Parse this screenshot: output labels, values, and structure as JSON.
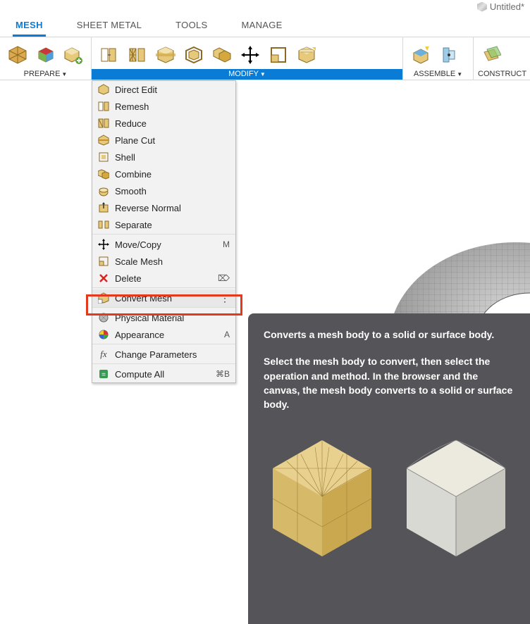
{
  "title": {
    "label": "Untitled*"
  },
  "tabs": [
    {
      "label": "MESH",
      "active": true
    },
    {
      "label": "SHEET METAL",
      "active": false
    },
    {
      "label": "TOOLS",
      "active": false
    },
    {
      "label": "MANAGE",
      "active": false
    }
  ],
  "ribbon": {
    "prepare": {
      "label": "PREPARE"
    },
    "modify": {
      "label": "MODIFY"
    },
    "assemble": {
      "label": "ASSEMBLE"
    },
    "construct": {
      "label": "CONSTRUCT"
    }
  },
  "menu": {
    "items": [
      {
        "icon": "direct-edit-icon",
        "label": "Direct Edit",
        "shortcut": ""
      },
      {
        "icon": "remesh-icon",
        "label": "Remesh",
        "shortcut": ""
      },
      {
        "icon": "reduce-icon",
        "label": "Reduce",
        "shortcut": ""
      },
      {
        "icon": "plane-cut-icon",
        "label": "Plane Cut",
        "shortcut": ""
      },
      {
        "icon": "shell-icon",
        "label": "Shell",
        "shortcut": ""
      },
      {
        "icon": "combine-icon",
        "label": "Combine",
        "shortcut": ""
      },
      {
        "icon": "smooth-icon",
        "label": "Smooth",
        "shortcut": ""
      },
      {
        "icon": "reverse-normal-icon",
        "label": "Reverse Normal",
        "shortcut": ""
      },
      {
        "icon": "separate-icon",
        "label": "Separate",
        "shortcut": ""
      },
      {
        "icon": "move-copy-icon",
        "label": "Move/Copy",
        "shortcut": "M"
      },
      {
        "icon": "scale-mesh-icon",
        "label": "Scale Mesh",
        "shortcut": ""
      },
      {
        "icon": "delete-icon",
        "label": "Delete",
        "shortcut": "⌦"
      },
      {
        "icon": "convert-mesh-icon",
        "label": "Convert Mesh",
        "shortcut": "",
        "highlighted": true,
        "more": true
      },
      {
        "icon": "physical-material-icon",
        "label": "Physical Material",
        "shortcut": ""
      },
      {
        "icon": "appearance-icon",
        "label": "Appearance",
        "shortcut": "A"
      },
      {
        "icon": "change-parameters-icon",
        "label": "Change Parameters",
        "shortcut": ""
      },
      {
        "icon": "compute-all-icon",
        "label": "Compute All",
        "shortcut": "⌘B"
      }
    ]
  },
  "tooltip": {
    "p1": "Converts a mesh body to a solid or surface body.",
    "p2": "Select the mesh body to convert, then select the operation and method. In the browser and the canvas, the mesh body converts to a solid or surface body."
  }
}
